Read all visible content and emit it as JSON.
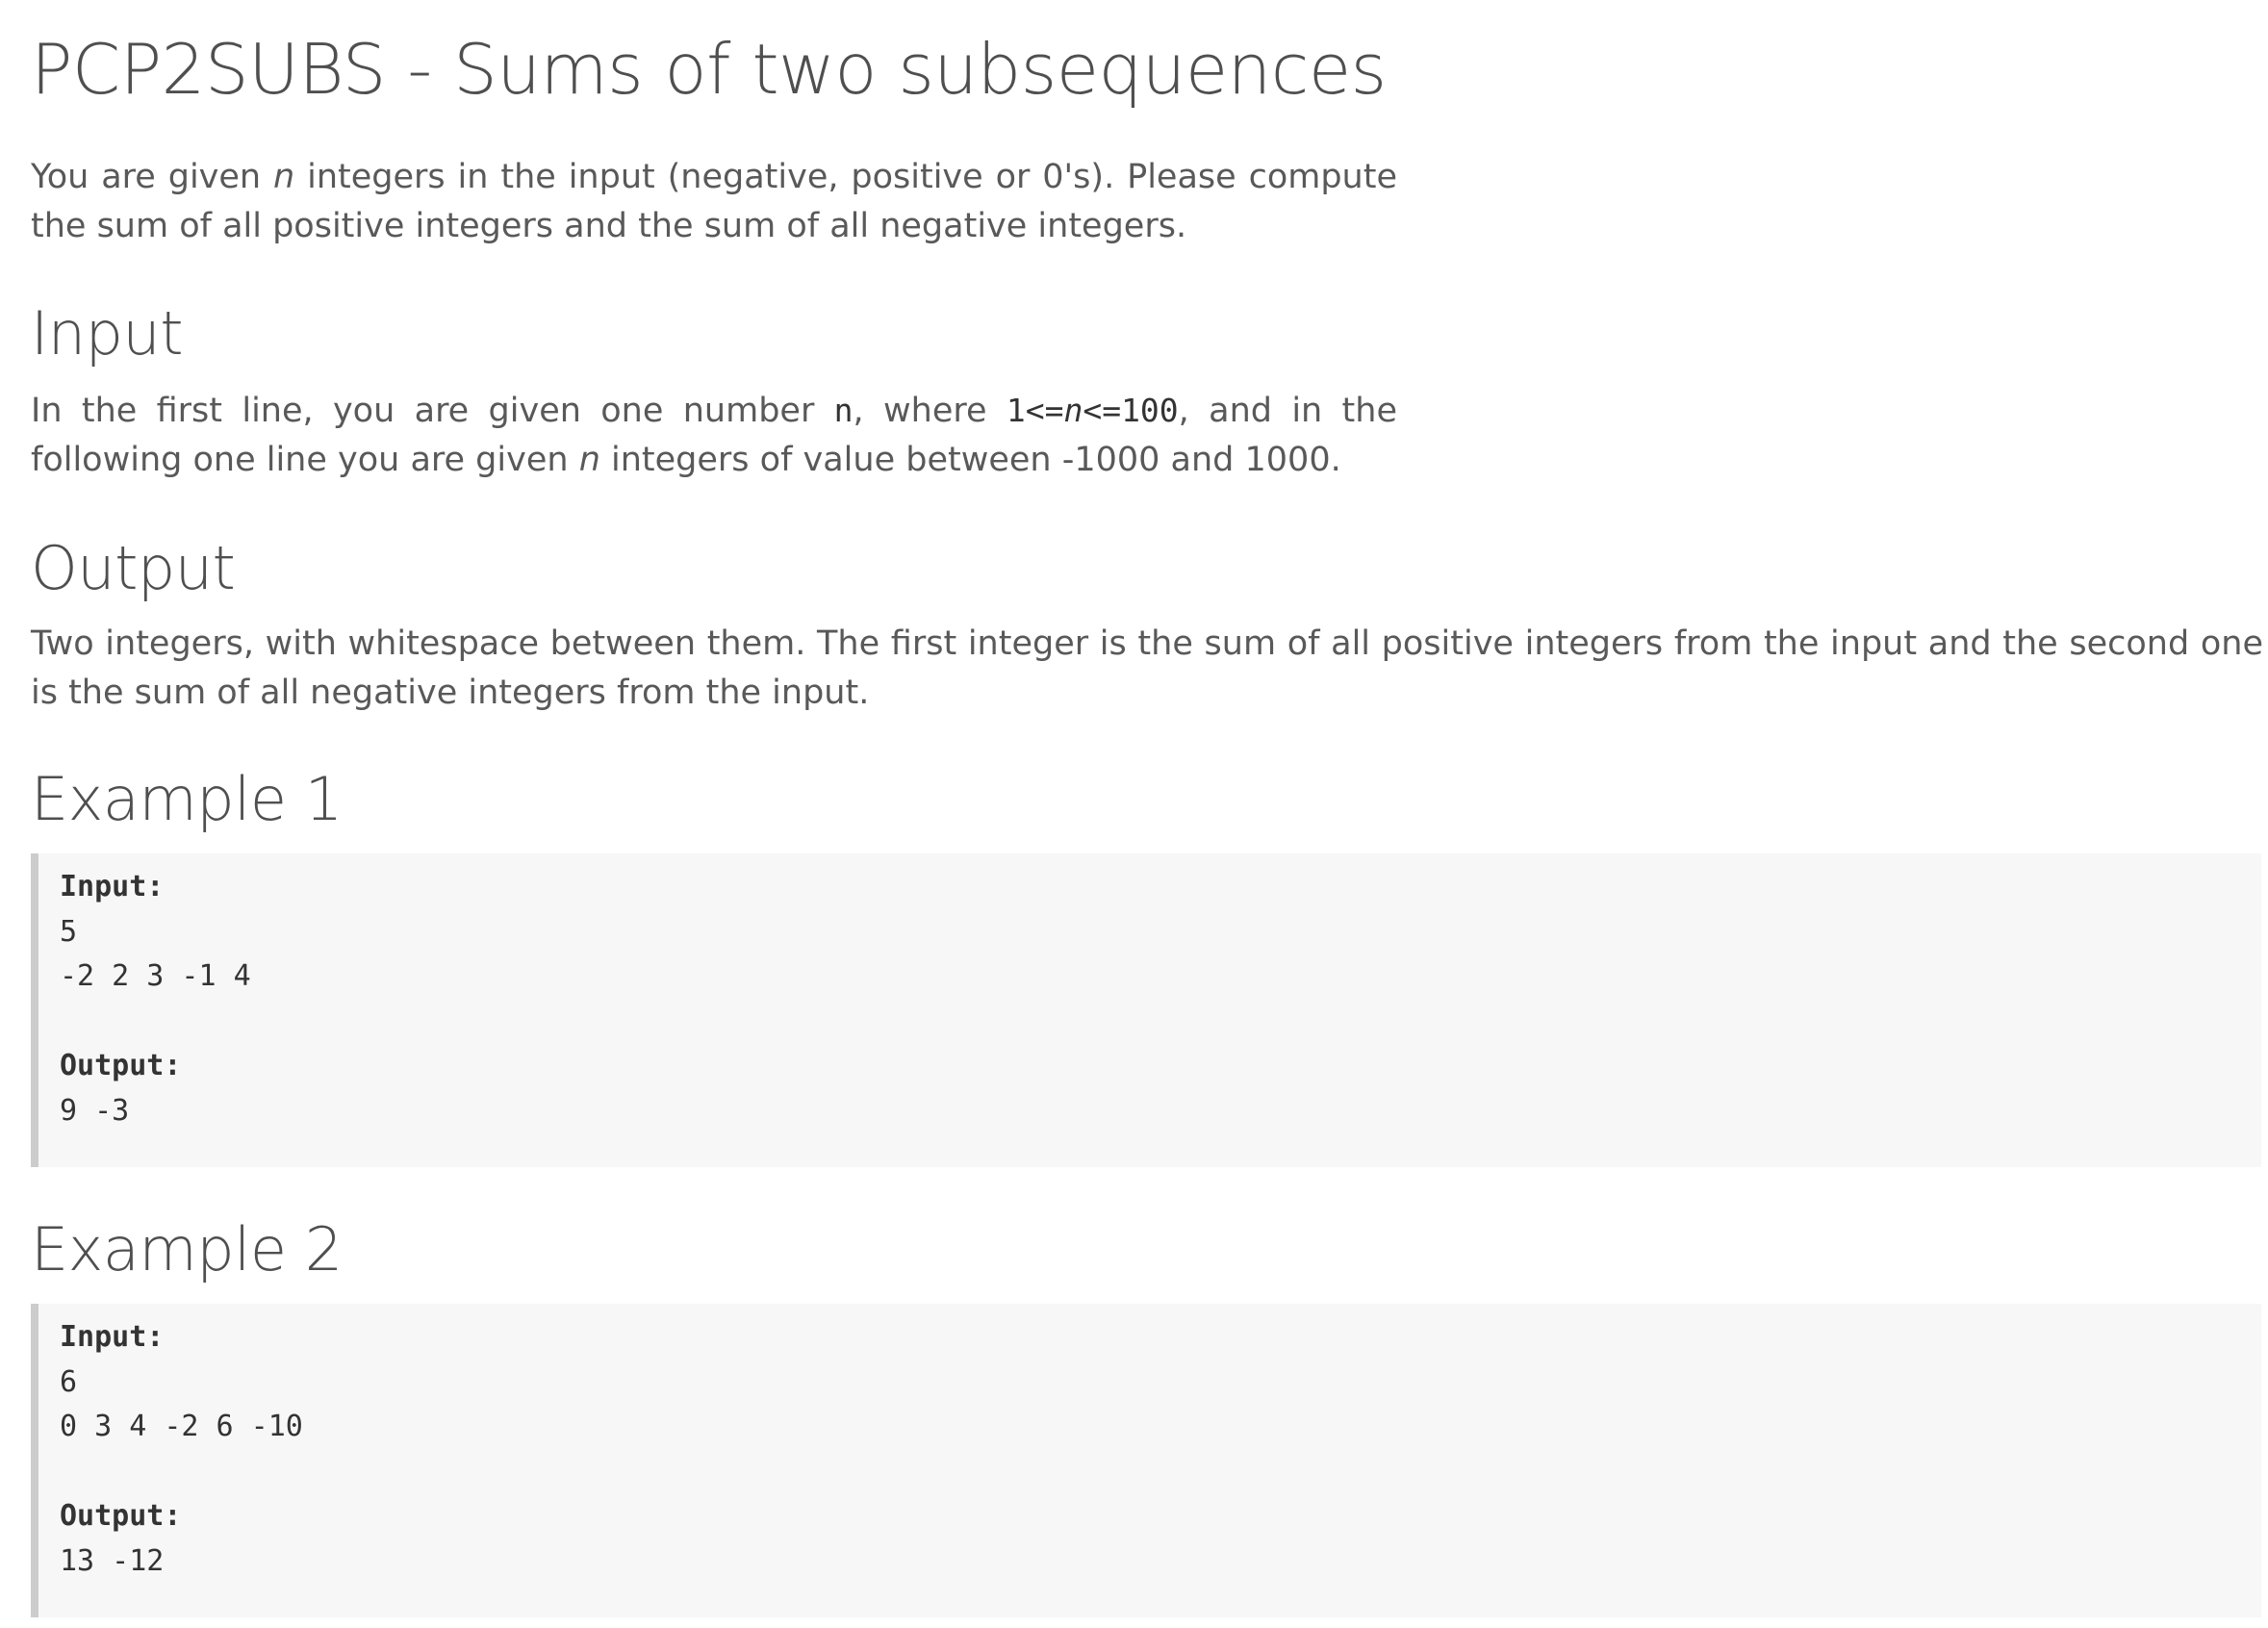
{
  "title": "PCP2SUBS - Sums of two subsequences",
  "intro": {
    "part1": "You are given ",
    "var_n": "n",
    "part2": " integers in the input (negative, positive or 0's). Please compute the sum of all positive integers and the sum of all negative integers."
  },
  "input_section": {
    "heading": "Input",
    "part1": "In the first line, you are given one number ",
    "code_n": "n",
    "part2": ", where ",
    "code_range_a": "1<=",
    "code_range_var": "n",
    "code_range_b": "<=100",
    "part3": ", and in the following one line you are given ",
    "var_n": "n",
    "part4": " integers of value between -1000 and 1000."
  },
  "output_section": {
    "heading": "Output",
    "text": "Two integers, with whitespace between them. The first integer is the sum of all positive integers from the input and the second one is the sum of all negative integers from the input."
  },
  "examples": [
    {
      "heading": "Example 1",
      "input_label": "Input:",
      "input_lines": [
        "5",
        "-2 2 3 -1 4"
      ],
      "output_label": "Output:",
      "output_line": "9 -3"
    },
    {
      "heading": "Example 2",
      "input_label": "Input:",
      "input_lines": [
        "6",
        "0 3 4 -2 6 -10"
      ],
      "output_label": "Output:",
      "output_line": "13 -12"
    }
  ]
}
